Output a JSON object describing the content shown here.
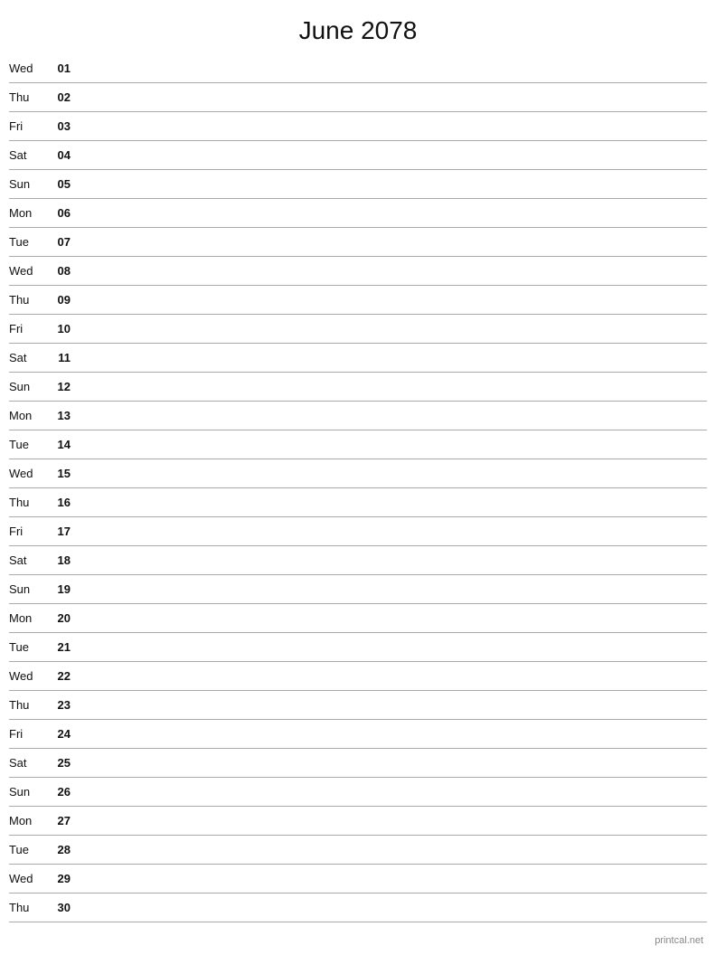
{
  "title": "June 2078",
  "watermark": "printcal.net",
  "days": [
    {
      "name": "Wed",
      "number": "01"
    },
    {
      "name": "Thu",
      "number": "02"
    },
    {
      "name": "Fri",
      "number": "03"
    },
    {
      "name": "Sat",
      "number": "04"
    },
    {
      "name": "Sun",
      "number": "05"
    },
    {
      "name": "Mon",
      "number": "06"
    },
    {
      "name": "Tue",
      "number": "07"
    },
    {
      "name": "Wed",
      "number": "08"
    },
    {
      "name": "Thu",
      "number": "09"
    },
    {
      "name": "Fri",
      "number": "10"
    },
    {
      "name": "Sat",
      "number": "11"
    },
    {
      "name": "Sun",
      "number": "12"
    },
    {
      "name": "Mon",
      "number": "13"
    },
    {
      "name": "Tue",
      "number": "14"
    },
    {
      "name": "Wed",
      "number": "15"
    },
    {
      "name": "Thu",
      "number": "16"
    },
    {
      "name": "Fri",
      "number": "17"
    },
    {
      "name": "Sat",
      "number": "18"
    },
    {
      "name": "Sun",
      "number": "19"
    },
    {
      "name": "Mon",
      "number": "20"
    },
    {
      "name": "Tue",
      "number": "21"
    },
    {
      "name": "Wed",
      "number": "22"
    },
    {
      "name": "Thu",
      "number": "23"
    },
    {
      "name": "Fri",
      "number": "24"
    },
    {
      "name": "Sat",
      "number": "25"
    },
    {
      "name": "Sun",
      "number": "26"
    },
    {
      "name": "Mon",
      "number": "27"
    },
    {
      "name": "Tue",
      "number": "28"
    },
    {
      "name": "Wed",
      "number": "29"
    },
    {
      "name": "Thu",
      "number": "30"
    }
  ]
}
